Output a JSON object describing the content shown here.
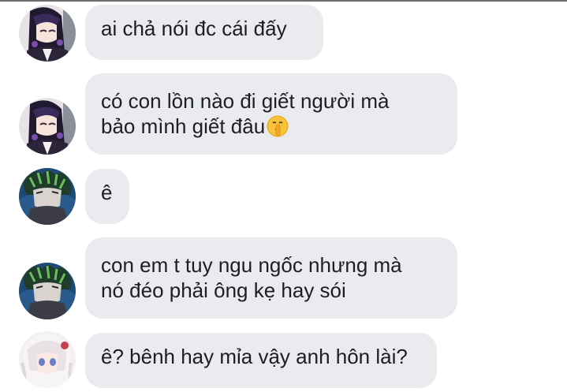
{
  "messages": [
    {
      "sender": "shinobu-avatar",
      "lines": [
        "ai chả nói đc cái đấy"
      ]
    },
    {
      "sender": "shinobu-avatar",
      "lines": [
        "có con lồn nào đi giết người mà",
        "bảo mình giết đâu"
      ],
      "emoji": "shushing-face-icon"
    },
    {
      "sender": "green-hair-avatar",
      "lines": [
        "ê"
      ]
    },
    {
      "sender": "green-hair-avatar",
      "lines": [
        "con em t tuy ngu ngốc nhưng mà",
        "nó đéo phải ông kẹ hay sói"
      ]
    },
    {
      "sender": "white-hair-avatar",
      "lines": [
        "ê? bênh hay mỉa vậy anh hôn lài?"
      ]
    }
  ],
  "colors": {
    "bubble_bg": "#e9ebee",
    "text": "#1c1e21",
    "top_border": "#6e6e6e"
  }
}
